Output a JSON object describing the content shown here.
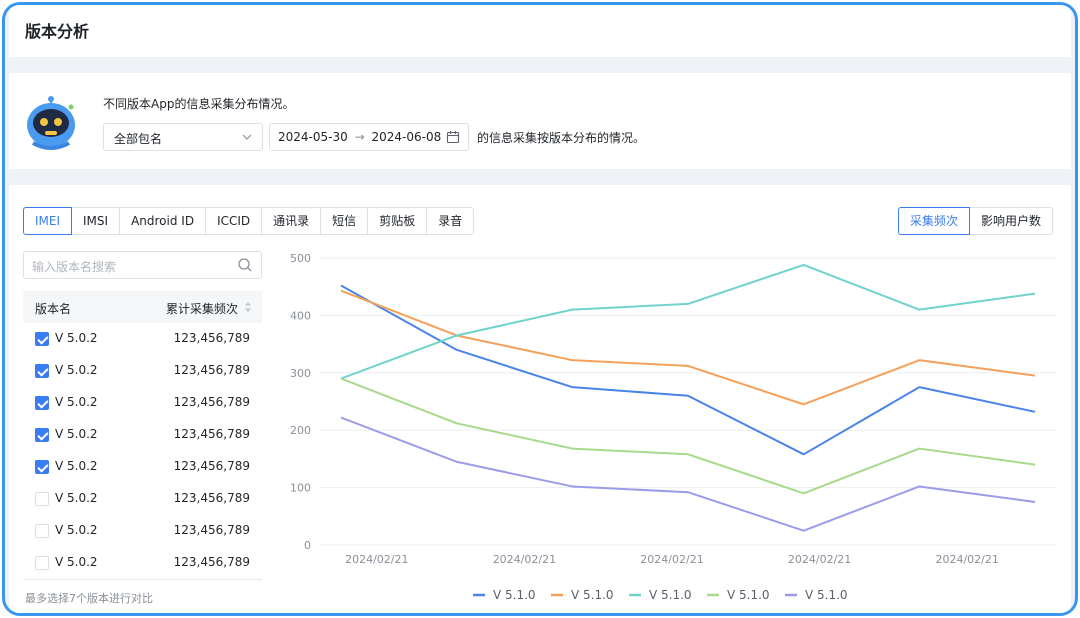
{
  "page": {
    "title": "版本分析"
  },
  "intro": {
    "description": "不同版本App的信息采集分布情况。",
    "package_select": "全部包名",
    "date_start": "2024-05-30",
    "date_sep": "→",
    "date_end": "2024-06-08",
    "range_suffix": "的信息采集按版本分布的情况。"
  },
  "tabs": [
    {
      "label": "IMEI",
      "active": true
    },
    {
      "label": "IMSI"
    },
    {
      "label": "Android ID"
    },
    {
      "label": "ICCID"
    },
    {
      "label": "通讯录"
    },
    {
      "label": "短信"
    },
    {
      "label": "剪贴板"
    },
    {
      "label": "录音"
    }
  ],
  "metric_toggle": [
    {
      "label": "采集频次",
      "active": true
    },
    {
      "label": "影响用户数"
    }
  ],
  "search": {
    "placeholder": "输入版本名搜索"
  },
  "table": {
    "col_name": "版本名",
    "col_count": "累计采集频次",
    "rows": [
      {
        "name": "V 5.0.2",
        "count": "123,456,789",
        "checked": true
      },
      {
        "name": "V 5.0.2",
        "count": "123,456,789",
        "checked": true
      },
      {
        "name": "V 5.0.2",
        "count": "123,456,789",
        "checked": true
      },
      {
        "name": "V 5.0.2",
        "count": "123,456,789",
        "checked": true
      },
      {
        "name": "V 5.0.2",
        "count": "123,456,789",
        "checked": true
      },
      {
        "name": "V 5.0.2",
        "count": "123,456,789",
        "checked": false
      },
      {
        "name": "V 5.0.2",
        "count": "123,456,789",
        "checked": false
      },
      {
        "name": "V 5.0.2",
        "count": "123,456,789",
        "checked": false
      }
    ]
  },
  "hint": "最多选择7个版本进行对比",
  "colors": {
    "accent": "#3a7df0",
    "frame": "#3a96f0"
  },
  "chart_data": {
    "type": "line",
    "x": [
      "2024/02/21",
      "",
      "2024/02/21",
      "",
      "2024/02/21",
      "",
      "2024/02/21",
      "",
      "2024/02/21",
      "",
      "2024/02/21"
    ],
    "x_tick_labels": [
      "2024/02/21",
      "2024/02/21",
      "2024/02/21",
      "2024/02/21",
      "2024/02/21"
    ],
    "ylim": [
      0,
      500
    ],
    "y_ticks": [
      0,
      100,
      200,
      300,
      400,
      500
    ],
    "grid": true,
    "legend_position": "bottom",
    "series": [
      {
        "name": "V 5.1.0",
        "color": "#4a84e8",
        "values": [
          452,
          340,
          275,
          260,
          158,
          275,
          232
        ]
      },
      {
        "name": "V 5.1.0",
        "color": "#f5a05a",
        "values": [
          443,
          365,
          322,
          312,
          245,
          322,
          295
        ]
      },
      {
        "name": "V 5.1.0",
        "color": "#6fd3cc",
        "values": [
          290,
          365,
          410,
          420,
          488,
          410,
          438
        ]
      },
      {
        "name": "V 5.1.0",
        "color": "#a6d98a",
        "values": [
          290,
          212,
          168,
          158,
          90,
          168,
          140
        ]
      },
      {
        "name": "V 5.1.0",
        "color": "#9a9ce8",
        "values": [
          222,
          145,
          102,
          92,
          25,
          102,
          75
        ]
      }
    ]
  }
}
